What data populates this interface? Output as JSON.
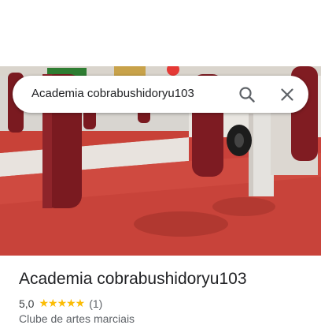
{
  "search": {
    "query": "Academia cobrabushidoryu103"
  },
  "place": {
    "title": "Academia cobrabushidoryu103",
    "rating": "5,0",
    "stars": "★★★★★",
    "review_count": "(1)",
    "category": "Clube de artes marciais"
  },
  "icons": {
    "search": "search-icon",
    "close": "close-icon"
  },
  "colors": {
    "floor": "#c9413a",
    "stars": "#fbbc04",
    "title_text": "#202124",
    "secondary_text": "#5f6368"
  }
}
